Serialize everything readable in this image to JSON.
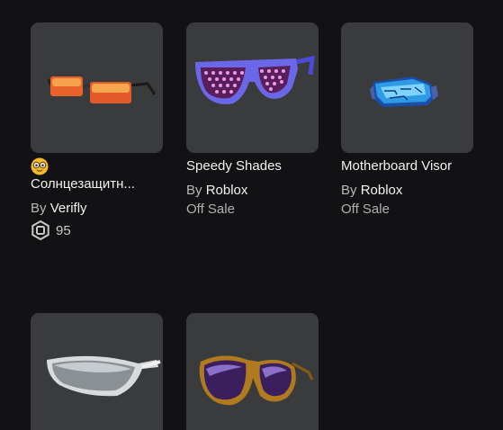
{
  "items": [
    {
      "name": "Солнцезащитн...",
      "by": "By",
      "creator": "Verifly",
      "price": "95",
      "price_icon": "robux-icon",
      "badge_icon": "nerd-face-emoji-icon",
      "thumbnail_icon": "orange-rectangular-sunglasses"
    },
    {
      "name": "Speedy Shades",
      "by": "By",
      "creator": "Roblox",
      "status": "Off Sale",
      "thumbnail_icon": "purple-studded-shades"
    },
    {
      "name": "Motherboard Visor",
      "by": "By",
      "creator": "Roblox",
      "status": "Off Sale",
      "thumbnail_icon": "blue-circuit-visor"
    },
    {
      "thumbnail_icon": "silver-sport-sunglasses"
    },
    {
      "thumbnail_icon": "gold-aviator-sunglasses"
    }
  ],
  "colors": {
    "background": "#121215",
    "card": "#393b3d",
    "text_primary": "#f2f2f2",
    "text_secondary": "#b8b8b8"
  }
}
